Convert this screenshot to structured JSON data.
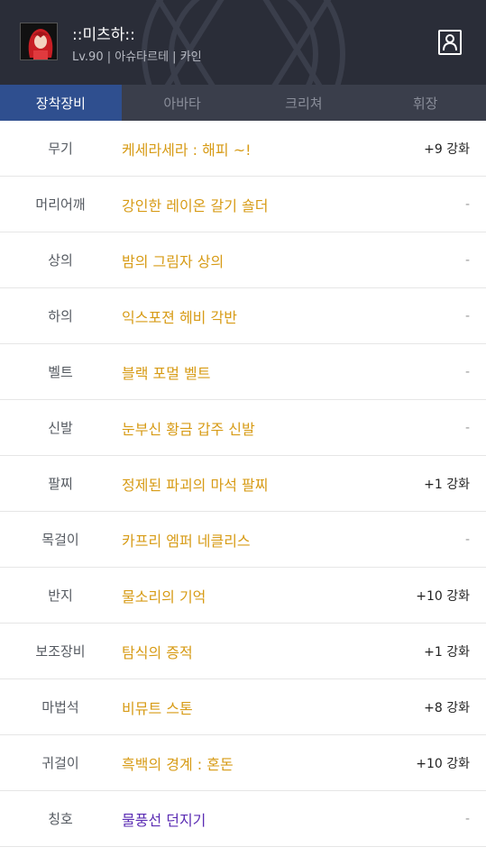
{
  "header": {
    "char_name": "::미츠하::",
    "char_info": "Lv.90 | 아슈타르테 | 카인"
  },
  "tabs": [
    {
      "label": "장착장비",
      "active": true
    },
    {
      "label": "아바타",
      "active": false
    },
    {
      "label": "크리쳐",
      "active": false
    },
    {
      "label": "휘장",
      "active": false
    }
  ],
  "equipment": [
    {
      "slot": "무기",
      "item": "케세라세라 : 해피 ~!",
      "enhance": "+9 강화"
    },
    {
      "slot": "머리어깨",
      "item": "강인한 레이온 갈기 숄더",
      "enhance": "-"
    },
    {
      "slot": "상의",
      "item": "밤의 그림자 상의",
      "enhance": "-"
    },
    {
      "slot": "하의",
      "item": "익스포젼 헤비 각반",
      "enhance": "-"
    },
    {
      "slot": "벨트",
      "item": "블랙 포멀 벨트",
      "enhance": "-"
    },
    {
      "slot": "신발",
      "item": "눈부신 황금 갑주 신발",
      "enhance": "-"
    },
    {
      "slot": "팔찌",
      "item": "정제된 파괴의 마석 팔찌",
      "enhance": "+1 강화"
    },
    {
      "slot": "목걸이",
      "item": "카프리 엠퍼 네클리스",
      "enhance": "-"
    },
    {
      "slot": "반지",
      "item": "물소리의 기억",
      "enhance": "+10 강화"
    },
    {
      "slot": "보조장비",
      "item": "탐식의 증적",
      "enhance": "+1 강화"
    },
    {
      "slot": "마법석",
      "item": "비뮤트 스톤",
      "enhance": "+8 강화"
    },
    {
      "slot": "귀걸이",
      "item": "흑백의 경계 : 혼돈",
      "enhance": "+10 강화"
    },
    {
      "slot": "칭호",
      "item": "물풍선 던지기",
      "enhance": "-",
      "rarity": "purple"
    }
  ],
  "colors": {
    "header_bg": "#2a2d38",
    "tab_active": "#2f4f8f",
    "item_gold": "#d79b16",
    "item_purple": "#5a2bb3"
  }
}
